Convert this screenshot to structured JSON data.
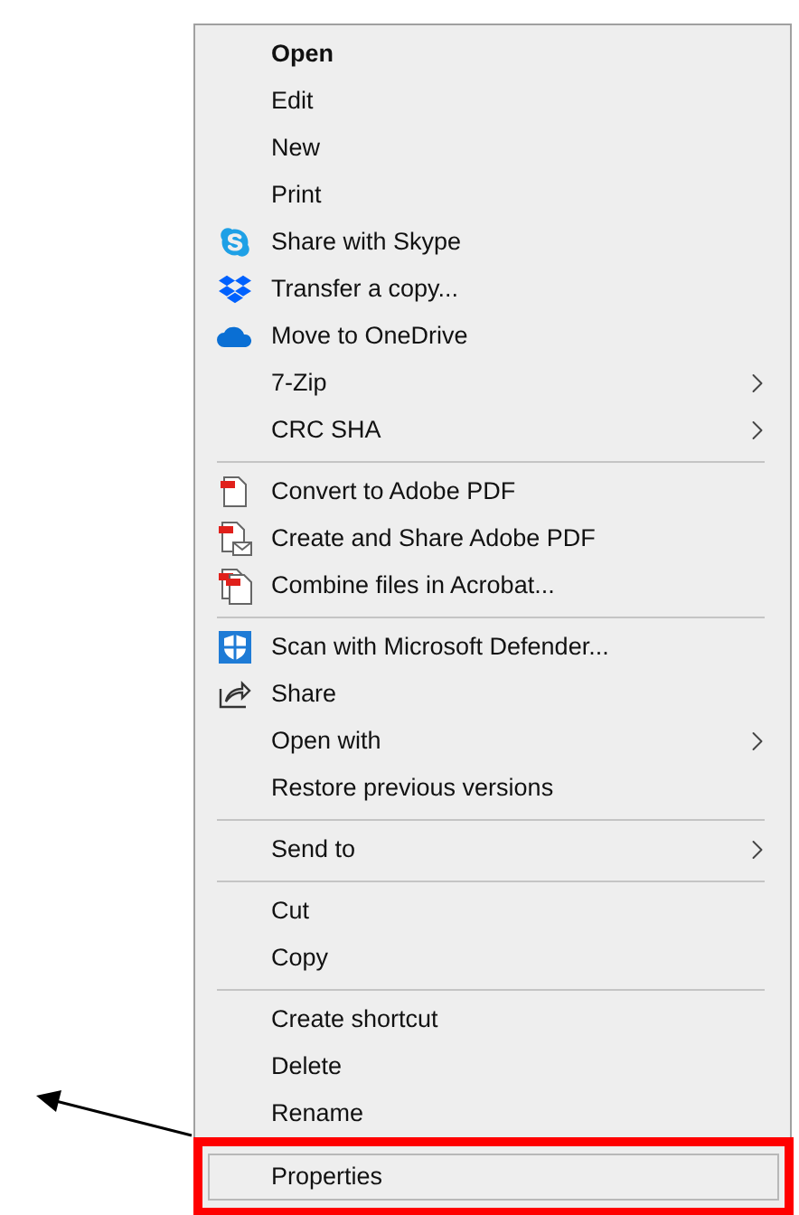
{
  "context_menu": {
    "groups": [
      [
        {
          "label": "Open",
          "kind": "none",
          "submenu": false,
          "default": true,
          "highlighted": false
        },
        {
          "label": "Edit",
          "kind": "none",
          "submenu": false,
          "default": false,
          "highlighted": false
        },
        {
          "label": "New",
          "kind": "none",
          "submenu": false,
          "default": false,
          "highlighted": false
        },
        {
          "label": "Print",
          "kind": "none",
          "submenu": false,
          "default": false,
          "highlighted": false
        },
        {
          "label": "Share with Skype",
          "kind": "skype",
          "submenu": false,
          "default": false,
          "highlighted": false
        },
        {
          "label": "Transfer a copy...",
          "kind": "dropbox",
          "submenu": false,
          "default": false,
          "highlighted": false
        },
        {
          "label": "Move to OneDrive",
          "kind": "cloud",
          "submenu": false,
          "default": false,
          "highlighted": false
        },
        {
          "label": "7-Zip",
          "kind": "none",
          "submenu": true,
          "default": false,
          "highlighted": false
        },
        {
          "label": "CRC SHA",
          "kind": "none",
          "submenu": true,
          "default": false,
          "highlighted": false
        }
      ],
      [
        {
          "label": "Convert to Adobe PDF",
          "kind": "pdf",
          "submenu": false,
          "default": false,
          "highlighted": false
        },
        {
          "label": "Create and Share Adobe PDF",
          "kind": "pdf-mail",
          "submenu": false,
          "default": false,
          "highlighted": false
        },
        {
          "label": "Combine files in Acrobat...",
          "kind": "pdf-stack",
          "submenu": false,
          "default": false,
          "highlighted": false
        }
      ],
      [
        {
          "label": "Scan with Microsoft Defender...",
          "kind": "shield",
          "submenu": false,
          "default": false,
          "highlighted": false
        },
        {
          "label": "Share",
          "kind": "share",
          "submenu": false,
          "default": false,
          "highlighted": false
        },
        {
          "label": "Open with",
          "kind": "none",
          "submenu": true,
          "default": false,
          "highlighted": false
        },
        {
          "label": "Restore previous versions",
          "kind": "none",
          "submenu": false,
          "default": false,
          "highlighted": false
        }
      ],
      [
        {
          "label": "Send to",
          "kind": "none",
          "submenu": true,
          "default": false,
          "highlighted": false
        }
      ],
      [
        {
          "label": "Cut",
          "kind": "none",
          "submenu": false,
          "default": false,
          "highlighted": false
        },
        {
          "label": "Copy",
          "kind": "none",
          "submenu": false,
          "default": false,
          "highlighted": false
        }
      ],
      [
        {
          "label": "Create shortcut",
          "kind": "none",
          "submenu": false,
          "default": false,
          "highlighted": false
        },
        {
          "label": "Delete",
          "kind": "none",
          "submenu": false,
          "default": false,
          "highlighted": false
        },
        {
          "label": "Rename",
          "kind": "none",
          "submenu": false,
          "default": false,
          "highlighted": false
        }
      ],
      [
        {
          "label": "Properties",
          "kind": "none",
          "submenu": false,
          "default": false,
          "highlighted": true
        }
      ]
    ]
  }
}
